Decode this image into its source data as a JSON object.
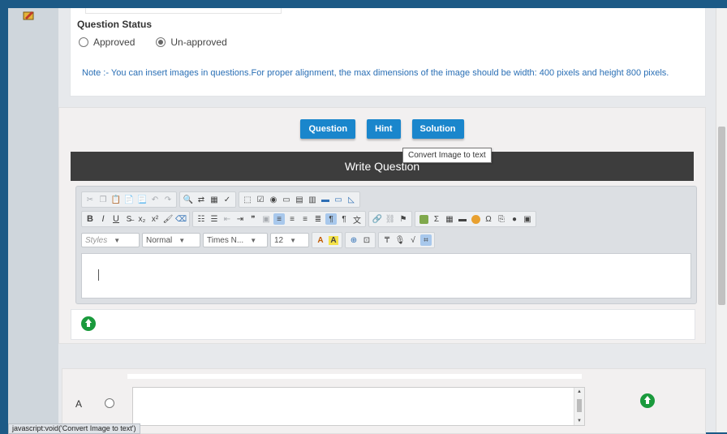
{
  "question_status": {
    "title": "Question Status",
    "options": [
      {
        "label": "Approved",
        "selected": false
      },
      {
        "label": "Un-approved",
        "selected": true
      }
    ]
  },
  "note": "Note :- You can insert images in questions.For proper alignment, the max dimensions of the image should be width: 400 pixels and height 800 pixels.",
  "tabs": [
    {
      "label": "Question"
    },
    {
      "label": "Hint"
    },
    {
      "label": "Solution"
    }
  ],
  "editor": {
    "header": "Write Question",
    "styles_combo": "Styles",
    "format_combo": "Normal",
    "font_combo": "Times N...",
    "size_combo": "12",
    "tooltip": "Convert Image to text"
  },
  "answer_option": {
    "letter": "A"
  },
  "status_bar": "javascript:void('Convert Image to text')",
  "colors": {
    "accent_blue": "#1a86cc",
    "header_dark": "#3d3d3d",
    "upload_green": "#1a9a3c",
    "frame_blue": "#1c5a86"
  }
}
